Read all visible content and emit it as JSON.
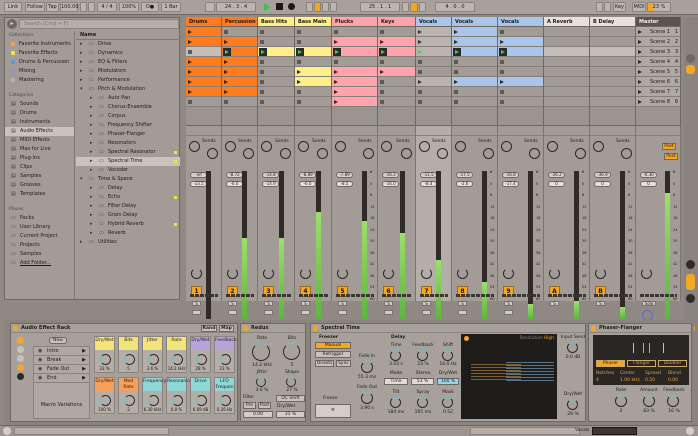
{
  "toolbar": {
    "link": "Link",
    "follow": "Follow",
    "tap": "Tap",
    "tempo": "100.00",
    "signature": "4 / 4",
    "zoom": "100%",
    "metro": "O●",
    "quantize": "1 Bar",
    "position": "24 .  3 .  4",
    "loop_start": "25 .  1 .  1",
    "loop_length": "4 .  0 .  0",
    "key": "Key",
    "midi": "MIDI",
    "cpu": "23 %"
  },
  "browser": {
    "search_placeholder": "Search (Cmd + F)",
    "collections_title": "Collections",
    "collections": [
      {
        "label": "Favorite Instruments",
        "color": "#f5a04a"
      },
      {
        "label": "Favorite Effects",
        "color": "#f4e04a"
      },
      {
        "label": "Drums & Percussion",
        "color": "#5a9ad8"
      },
      {
        "label": "Mixing",
        "color": "#a58ac8"
      },
      {
        "label": "Mastering",
        "color": "#b8b2ad"
      }
    ],
    "categories_title": "Categories",
    "categories": [
      "Sounds",
      "Drums",
      "Instruments",
      "Audio Effects",
      "MIDI Effects",
      "Max for Live",
      "Plug-Ins",
      "Clips",
      "Samples",
      "Grooves",
      "Templates"
    ],
    "selected_category": "Audio Effects",
    "places_title": "Places",
    "places": [
      "Packs",
      "User Library",
      "Current Project",
      "Projects",
      "Samples",
      "Add Folder..."
    ],
    "name_header": "Name",
    "items": [
      {
        "label": "Drive",
        "level": 0,
        "starred": false
      },
      {
        "label": "Dynamics",
        "level": 0,
        "starred": false
      },
      {
        "label": "EQ & Filters",
        "level": 0,
        "starred": false
      },
      {
        "label": "Modulators",
        "level": 0,
        "starred": false
      },
      {
        "label": "Performance",
        "level": 0,
        "starred": false
      },
      {
        "label": "Pitch & Modulation",
        "level": 0,
        "open": true,
        "starred": false
      },
      {
        "label": "Auto Pan",
        "level": 1,
        "starred": false
      },
      {
        "label": "Chorus-Ensemble",
        "level": 1,
        "starred": false
      },
      {
        "label": "Corpus",
        "level": 1,
        "starred": false
      },
      {
        "label": "Frequency Shifter",
        "level": 1,
        "starred": false
      },
      {
        "label": "Phaser-Flanger",
        "level": 1,
        "starred": false
      },
      {
        "label": "Resonators",
        "level": 1,
        "starred": false
      },
      {
        "label": "Spectral Resonator",
        "level": 1,
        "starred": true
      },
      {
        "label": "Spectral Time",
        "level": 1,
        "starred": true,
        "selected": true
      },
      {
        "label": "Vocoder",
        "level": 1,
        "starred": false
      },
      {
        "label": "Time & Space",
        "level": 0,
        "open": true,
        "starred": false
      },
      {
        "label": "Delay",
        "level": 1,
        "starred": false
      },
      {
        "label": "Echo",
        "level": 1,
        "starred": true
      },
      {
        "label": "Filter Delay",
        "level": 1,
        "starred": false
      },
      {
        "label": "Grain Delay",
        "level": 1,
        "starred": false
      },
      {
        "label": "Hybrid Reverb",
        "level": 1,
        "starred": true
      },
      {
        "label": "Reverb",
        "level": 1,
        "starred": false
      },
      {
        "label": "Utilities",
        "level": 0,
        "starred": false
      }
    ]
  },
  "tracks": [
    {
      "name": "Drums",
      "color": "#ff7b1c",
      "number": "1",
      "vol": "-inf",
      "vol2": "-13.5",
      "meter": 0,
      "clips": [
        "clip",
        "clip",
        "stop",
        "clip",
        "clip",
        "clip",
        "clip",
        "stop"
      ]
    },
    {
      "name": "Percussion",
      "color": "#ff7b1c",
      "number": "2",
      "vol": "-8.72",
      "vol2": "-6.0",
      "meter": 0.55,
      "clips": [
        "stop",
        "clip",
        "playing",
        "clip",
        "clip",
        "clip",
        "clip",
        "stop"
      ]
    },
    {
      "name": "Bass Hits",
      "color": "#ffef8a",
      "number": "3",
      "vol": "-14.8",
      "vol2": "-14.9",
      "meter": 0.55,
      "clips": [
        "stop",
        "stop",
        "playing",
        "stop",
        "stop",
        "stop",
        "stop",
        "stop"
      ]
    },
    {
      "name": "Bass Main",
      "color": "#ffef8a",
      "number": "4",
      "vol": "-8.89",
      "vol2": "-6.0",
      "meter": 0.72,
      "clips": [
        "stop",
        "stop",
        "playing",
        "stop",
        "clip",
        "clip",
        "stop",
        "stop"
      ]
    },
    {
      "name": "Plucks",
      "color": "#ffa4ad",
      "number": "5",
      "vol": "-7.89",
      "vol2": "-8.5",
      "meter": 0.66,
      "clips": [
        "stop",
        "clip",
        "playing",
        "stop",
        "clip",
        "clip",
        "clip",
        "clip"
      ]
    },
    {
      "name": "Keys",
      "color": "#ffa4ad",
      "number": "6",
      "vol": "-16.3",
      "vol2": "-16.0",
      "meter": 0.58,
      "clips": [
        "stop",
        "clip",
        "playing",
        "stop",
        "clip",
        "stop",
        "stop",
        "stop"
      ]
    },
    {
      "name": "Vocals",
      "color": "#a9c6ea",
      "number": "7",
      "vol": "-11.5",
      "vol2": "-8.4",
      "meter": 0.4,
      "clips": [
        "group",
        "group",
        "groupplay",
        "stop",
        "stop",
        "group",
        "stop",
        "stop"
      ]
    },
    {
      "name": "Vocals",
      "color": "#a9c6ea",
      "number": "8",
      "vol": "-17.5",
      "vol2": "-2.6",
      "meter": 0.25,
      "clips": [
        "clip",
        "clip",
        "playing",
        "stop",
        "stop",
        "clip",
        "stop",
        "stop"
      ]
    },
    {
      "name": "Vocals",
      "color": "#a9c6ea",
      "number": "9",
      "vol": "-16.8",
      "vol2": "-17.4",
      "meter": 0.1,
      "clips": [
        "stop",
        "clip",
        "playing",
        "stop",
        "stop",
        "clip",
        "stop",
        "stop"
      ]
    },
    {
      "name": "A Reverb",
      "color": "#e6e1dc",
      "number": "A",
      "vol": "-26.2",
      "vol2": "0",
      "meter": 0.12,
      "clips": [
        "",
        "",
        "",
        "",
        "",
        "",
        "",
        ""
      ]
    },
    {
      "name": "B Delay",
      "color": "#e6e1dc",
      "number": "B",
      "vol": "-36.9",
      "vol2": "0",
      "meter": 0.08,
      "clips": [
        "",
        "",
        "",
        "",
        "",
        "",
        "",
        ""
      ]
    },
    {
      "name": "Master",
      "color": "#5a5551",
      "number": "",
      "vol": "-0.30",
      "vol2": "0",
      "meter": 0.85,
      "clips": [
        "",
        "",
        "",
        "",
        "",
        "",
        "",
        ""
      ]
    }
  ],
  "scenes": [
    "Scene 1",
    "Scene 2",
    "Scene 3",
    "Scene 4",
    "Scene 5",
    "Scene 6",
    "Scene 7",
    "Scene 8"
  ],
  "mixer": {
    "sends_label": "Sends",
    "solo": "S",
    "post": "Post",
    "solo_master": "Solo",
    "scale": [
      "6",
      "0",
      "6",
      "12",
      "18",
      "24",
      "30",
      "36",
      "42",
      "48",
      "54",
      "60"
    ]
  },
  "rack": {
    "title": "Audio Effect Rack",
    "rand": "Rand",
    "map": "Map",
    "new": "New",
    "variations": [
      "Intro",
      "Break",
      "Fade Out",
      "End"
    ],
    "variations_label": "Macro Variations",
    "macros": [
      {
        "label": "Dry/Wet",
        "value": "33 %",
        "color": "#f2e37a"
      },
      {
        "label": "Bits",
        "value": "5",
        "color": "#f2e37a"
      },
      {
        "label": "Jitter",
        "value": "3.6 %",
        "color": "#f2e37a"
      },
      {
        "label": "Rate",
        "value": "14.2 kHz",
        "color": "#f2e37a"
      },
      {
        "label": "Dry/Wet",
        "value": "28 %",
        "color": "#b9a3dc"
      },
      {
        "label": "Feedback",
        "value": "23 %",
        "color": "#b9a3dc"
      },
      {
        "label": "Dry/Wet",
        "value": "100 %",
        "color": "#f7a05a"
      },
      {
        "label": "Mod Rate",
        "value": "2",
        "color": "#f7a05a"
      },
      {
        "label": "Frequency",
        "value": "6.30 kHz",
        "color": "#8fd6d6"
      },
      {
        "label": "Resonance",
        "value": "0.0 %",
        "color": "#8fd6d6"
      },
      {
        "label": "Drive",
        "value": "6.69 dB",
        "color": "#8fd6d6"
      },
      {
        "label": "LFO Frequen",
        "value": "0.26 Hz",
        "color": "#8fd6d6"
      }
    ]
  },
  "redux": {
    "title": "Redux",
    "rate_label": "Rate",
    "rate": "14.2 kHz",
    "bits_label": "Bits",
    "bits": "5",
    "jitter_label": "Jitter",
    "jitter": "3.6 %",
    "shape_label": "Shape",
    "shape": "27 %",
    "filter_label": "Filter",
    "pre": "Pre",
    "post": "Post",
    "filter_val": "0.00",
    "dc_shift": "DC Shift",
    "drywet_label": "Dry/Wet",
    "drywet": "31 %"
  },
  "spectral": {
    "title": "Spectral Time",
    "freezer": "Freezer",
    "manual": "Manual",
    "retrigger": "Retrigger",
    "onsets": "Onsets",
    "sync": "Sync",
    "fade_in_label": "Fade In",
    "fade_in": "55.3 ms",
    "fade_out_label": "Fade Out",
    "fade_out": "3.90 s",
    "freeze": "Freeze",
    "delay": "Delay",
    "time_label": "Time",
    "time": "3.03 s",
    "feedback_label": "Feedback",
    "feedback": "23 %",
    "shift_label": "Shift",
    "shift": "16.0 Hz",
    "mode_label": "Mode",
    "mode": "Time",
    "stereo_label": "Stereo",
    "stereo": "53 %",
    "drywet_label": "Dry/Wet",
    "drywet": "100 %",
    "tilt_label": "Tilt",
    "tilt": "184 ms",
    "spray_label": "Spray",
    "spray": "165 ms",
    "mask_label": "Mask",
    "mask": "0.52",
    "resolution_label": "Resolution",
    "resolution": "High",
    "input_send_label": "Input Send",
    "input_send": "0.0 dB",
    "out_drywet_label": "Dry/Wet",
    "out_drywet": "28 %"
  },
  "phaser": {
    "title": "Phaser-Flanger",
    "modes": [
      "Phaser",
      "Flanger",
      "Doubler"
    ],
    "active_mode": "Phaser",
    "notches_label": "Notches",
    "notches": "4",
    "center_label": "Center",
    "center": "1.00 kHz",
    "spread_label": "Spread",
    "spread": "0.50",
    "blend_label": "Blend",
    "blend": "0.00",
    "rate_label": "Rate",
    "rate": "2",
    "amount_label": "Amount",
    "amount": "83 %",
    "feedback_label": "Feedback",
    "feedback": "16 %"
  },
  "status": {
    "track": "Vocals"
  }
}
